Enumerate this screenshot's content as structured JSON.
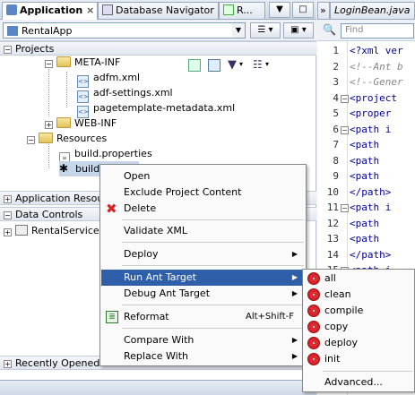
{
  "left_tabs": [
    {
      "label": "Application"
    },
    {
      "label": "Database Navigator"
    },
    {
      "label": "R..."
    }
  ],
  "editor_tab": {
    "label": "LoginBean.java"
  },
  "app_selector": {
    "value": "RentalApp"
  },
  "search": {
    "placeholder": "Find"
  },
  "sections": {
    "projects": "Projects",
    "app_resources": "Application Resourc",
    "data_controls": "Data Controls",
    "recent": "Recently Opened F"
  },
  "tree": {
    "meta_inf": "META-INF",
    "adfm": "adfm.xml",
    "adf_settings": "adf-settings.xml",
    "pagetemplate": "pagetemplate-metadata.xml",
    "web_inf": "WEB-INF",
    "resources": "Resources",
    "build_props": "build.properties",
    "build_xml": "build.",
    "rental_service": "RentalServiceD"
  },
  "editor": {
    "line_numbers": [
      "1",
      "2",
      "3",
      "4",
      "5",
      "6",
      "7",
      "8",
      "9",
      "10",
      "11",
      "12",
      "13",
      "14",
      "15"
    ],
    "lines": [
      {
        "parts": [
          {
            "t": "<?xml ver",
            "c": "tg"
          }
        ]
      },
      {
        "parts": [
          {
            "t": "<!--Ant b",
            "c": "cm"
          }
        ]
      },
      {
        "parts": [
          {
            "t": "<!--Gener",
            "c": "cm"
          }
        ]
      },
      {
        "parts": [
          {
            "t": "<project ",
            "c": "tg"
          }
        ]
      },
      {
        "parts": [
          {
            "t": "  <proper",
            "c": "tg"
          }
        ]
      },
      {
        "parts": [
          {
            "t": "  <path i",
            "c": "tg"
          }
        ]
      },
      {
        "parts": [
          {
            "t": "    <path",
            "c": "tg"
          }
        ]
      },
      {
        "parts": [
          {
            "t": "    <path",
            "c": "tg"
          }
        ]
      },
      {
        "parts": [
          {
            "t": "    <path",
            "c": "tg"
          }
        ]
      },
      {
        "parts": [
          {
            "t": "  </path>",
            "c": "tg"
          }
        ]
      },
      {
        "parts": [
          {
            "t": "  <path i",
            "c": "tg"
          }
        ]
      },
      {
        "parts": [
          {
            "t": "    <path",
            "c": "tg"
          }
        ]
      },
      {
        "parts": [
          {
            "t": "    <path",
            "c": "tg"
          }
        ]
      },
      {
        "parts": [
          {
            "t": "  </path>",
            "c": "tg"
          }
        ]
      },
      {
        "parts": [
          {
            "t": "  <path i",
            "c": "tg"
          }
        ]
      }
    ]
  },
  "context_menu": {
    "open": "Open",
    "exclude": "Exclude Project Content",
    "delete": "Delete",
    "validate": "Validate XML",
    "deploy": "Deploy",
    "run_ant": "Run Ant Target",
    "debug_ant": "Debug Ant Target",
    "reformat": "Reformat",
    "reformat_shortcut": "Alt+Shift-F",
    "compare": "Compare With",
    "replace": "Replace With"
  },
  "submenu": {
    "targets": [
      "all",
      "clean",
      "compile",
      "copy",
      "deploy",
      "init"
    ],
    "advanced": "Advanced..."
  },
  "colors": {
    "selection": "#2f5fa8",
    "target_icon": "#d9232a"
  }
}
